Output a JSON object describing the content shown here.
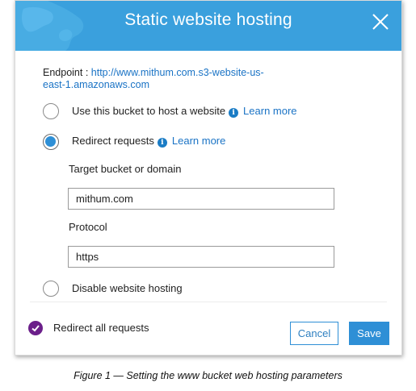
{
  "modal": {
    "title": "Static website hosting",
    "endpoint_label": "Endpoint : ",
    "endpoint_url_line1": "http://www.mithum.com.s3-website-us-",
    "endpoint_url_line2": "east-1.amazonaws.com"
  },
  "options": {
    "host": {
      "label": "Use this bucket to host a website",
      "learn_more": "Learn more",
      "checked": false
    },
    "redirect": {
      "label": "Redirect requests",
      "learn_more": "Learn more",
      "checked": true
    },
    "disable": {
      "label": "Disable website hosting",
      "checked": false
    }
  },
  "redirect_form": {
    "target_label": "Target bucket or domain",
    "target_value": "mithum.com",
    "protocol_label": "Protocol",
    "protocol_value": "https"
  },
  "footer": {
    "status_text": "Redirect all requests",
    "cancel_label": "Cancel",
    "save_label": "Save"
  },
  "caption": "Figure 1 — Setting the www bucket web hosting parameters",
  "colors": {
    "header": "#3aa0dd",
    "accent": "#2e8fd6",
    "status_check": "#6b1f8a"
  }
}
